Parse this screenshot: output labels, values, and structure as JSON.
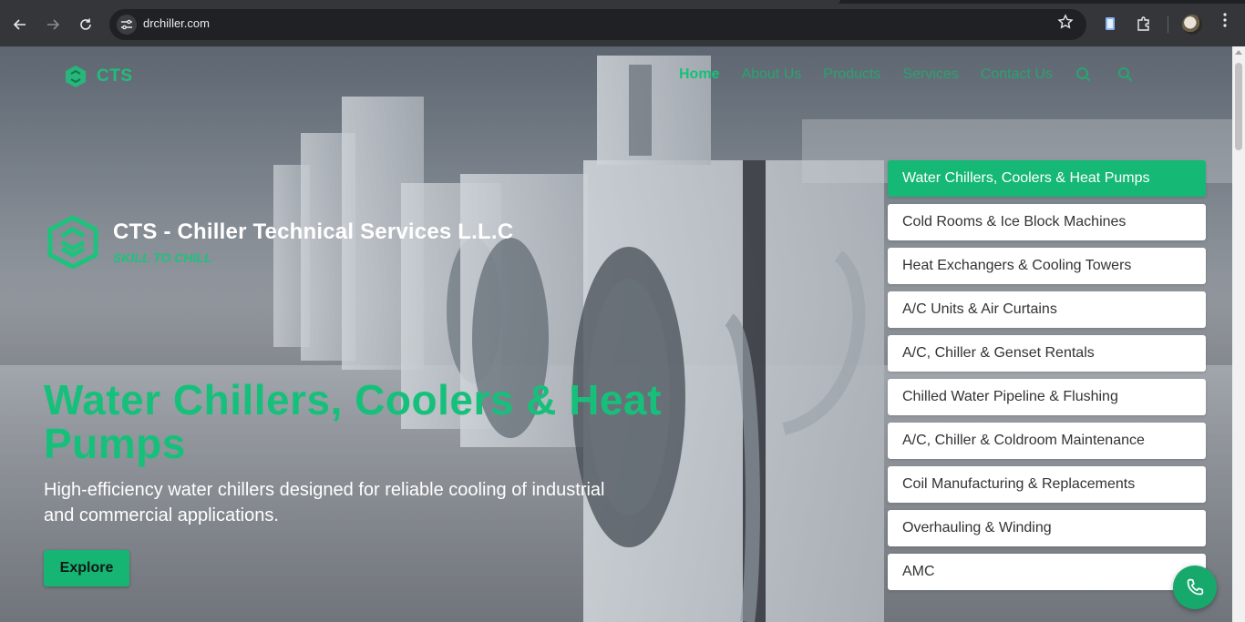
{
  "browser": {
    "url": "drchiller.com",
    "icons": {
      "back": "arrow-left-icon",
      "forward": "arrow-right-icon",
      "reload": "reload-icon",
      "site_info": "tune-icon",
      "bookmark": "star-icon",
      "extension1": "document-extension-icon",
      "extensions": "puzzle-icon",
      "profile": "avatar",
      "menu": "kebab-icon"
    }
  },
  "site": {
    "logo_text": "CTS",
    "nav": [
      "Home",
      "About Us",
      "Products",
      "Services",
      "Contact Us"
    ],
    "nav_active_index": 0,
    "nav_icons": [
      "search-icon",
      "user-search-icon"
    ],
    "brand": {
      "company": "CTS - Chiller Technical Services L.L.C",
      "tagline": "SKILL TO CHILL"
    },
    "hero": {
      "title": "Water Chillers, Coolers & Heat Pumps",
      "description": "High-efficiency water chillers designed for reliable cooling of industrial and commercial applications.",
      "button": "Explore"
    },
    "categories": [
      "Water Chillers, Coolers & Heat Pumps",
      "Cold Rooms & Ice Block Machines",
      "Heat Exchangers & Cooling Towers",
      "A/C Units & Air Curtains",
      "A/C, Chiller & Genset Rentals",
      "Chilled Water Pipeline & Flushing",
      "A/C, Chiller & Coldroom Maintenance",
      "Coil Manufacturing & Replacements",
      "Overhauling & Winding",
      "AMC"
    ],
    "categories_active_index": 0,
    "fab_icon": "phone-icon",
    "colors": {
      "brand_green": "#16c07b",
      "card_active": "#16b875",
      "card": "#ffffff"
    }
  }
}
